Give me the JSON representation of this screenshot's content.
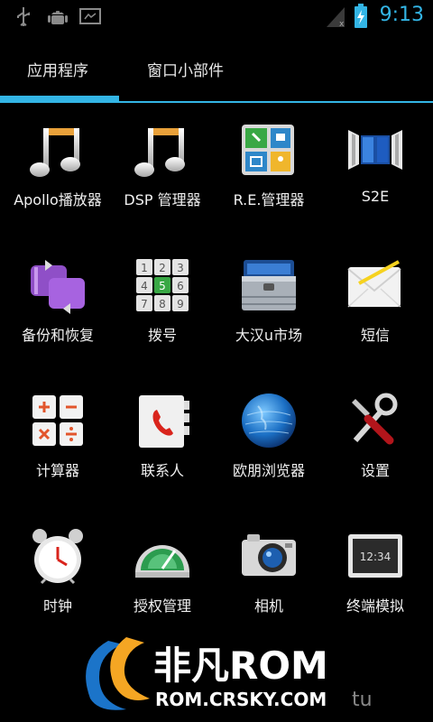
{
  "status_bar": {
    "time": "9:13",
    "icons": [
      "usb-icon",
      "android-debug-icon",
      "screenshot-icon",
      "signal-icon",
      "battery-charging-icon"
    ]
  },
  "tabs": [
    {
      "label": "应用程序",
      "selected": true
    },
    {
      "label": "窗口小部件",
      "selected": false
    }
  ],
  "apps": [
    {
      "label": "Apollo播放器",
      "icon": "music-note-icon"
    },
    {
      "label": "DSP 管理器",
      "icon": "music-note-icon"
    },
    {
      "label": "R.E.管理器",
      "icon": "re-manager-icon"
    },
    {
      "label": "S2E",
      "icon": "s2e-icon"
    },
    {
      "label": "备份和恢复",
      "icon": "backup-icon"
    },
    {
      "label": "拨号",
      "icon": "dialpad-icon"
    },
    {
      "label": "大汉u市场",
      "icon": "toolbox-icon"
    },
    {
      "label": "短信",
      "icon": "envelope-icon"
    },
    {
      "label": "计算器",
      "icon": "calculator-icon"
    },
    {
      "label": "联系人",
      "icon": "contacts-icon"
    },
    {
      "label": "欧朋浏览器",
      "icon": "globe-icon"
    },
    {
      "label": "设置",
      "icon": "tools-icon"
    },
    {
      "label": "时钟",
      "icon": "alarm-clock-icon"
    },
    {
      "label": "授权管理",
      "icon": "gauge-icon"
    },
    {
      "label": "相机",
      "icon": "camera-icon"
    },
    {
      "label": "终端模拟",
      "icon": "terminal-icon"
    }
  ],
  "dialpad_digits": [
    "1",
    "2",
    "3",
    "4",
    "5",
    "6",
    "7",
    "8",
    "9"
  ],
  "terminal_text": "12:34",
  "watermark": {
    "brand": "非凡ROM",
    "url": "ROM.CRSKY.COM",
    "suffix": "tu"
  },
  "colors": {
    "accent": "#33b5e5",
    "background": "#000000"
  }
}
